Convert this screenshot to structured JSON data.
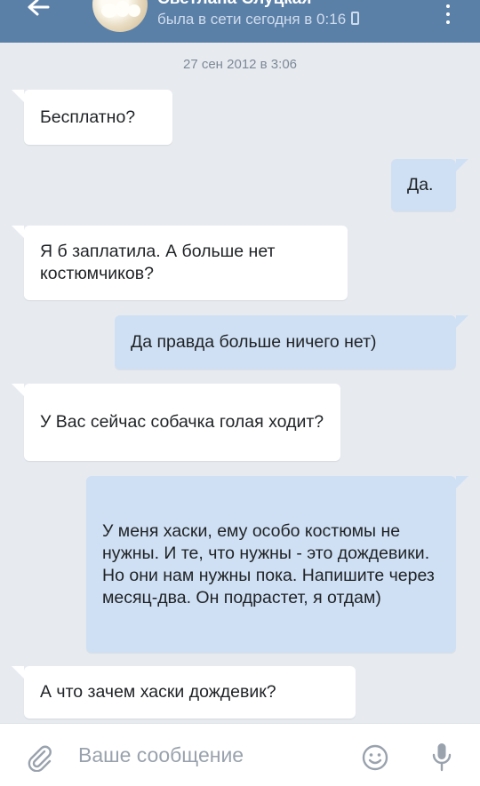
{
  "header": {
    "contact_name": "Светлана Слуцкая",
    "status": "была в сети сегодня в 0:16"
  },
  "chat": {
    "date": "27 сен 2012 в 3:06",
    "messages": [
      {
        "direction": "in",
        "text": "Бесплатно?"
      },
      {
        "direction": "out",
        "text": "Да."
      },
      {
        "direction": "in",
        "text": "Я б заплатила. А больше нет костюмчиков?"
      },
      {
        "direction": "out",
        "text": "Да правда больше ничего нет)"
      },
      {
        "direction": "in",
        "text": "У Вас сейчас собачка голая ходит?"
      },
      {
        "direction": "out",
        "text": "У меня хаски, ему особо костюмы не нужны. И те, что нужны - это дождевики. Но они нам нужны пока. Напишите через месяц-два. Он подрастет, я отдам)"
      },
      {
        "direction": "in",
        "text": "А что зачем хаски дождевик?"
      }
    ]
  },
  "composer": {
    "placeholder": "Ваше сообщение"
  },
  "colors": {
    "header_bg": "#5b80a8",
    "chat_bg": "#e7ebf0",
    "incoming_bubble": "#ffffff",
    "outgoing_bubble": "#cfe0f4"
  },
  "icons": [
    "back-arrow-icon",
    "online-phone-icon",
    "more-vertical-icon",
    "paperclip-icon",
    "smile-icon",
    "microphone-icon"
  ]
}
